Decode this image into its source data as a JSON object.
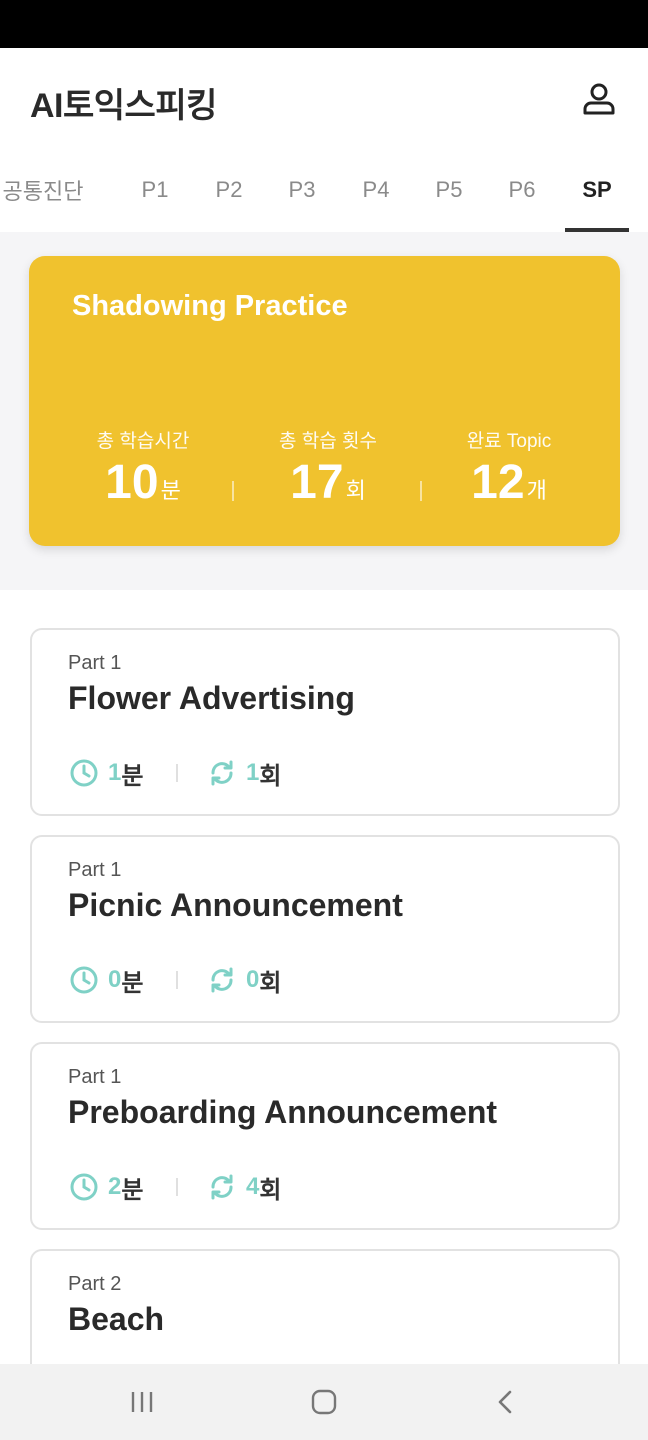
{
  "app": {
    "title": "AI토익스피킹"
  },
  "icons": {
    "profile": "person-icon",
    "time": "clock-icon",
    "count": "refresh-icon"
  },
  "colors": {
    "accent_yellow": "#f0c22e",
    "accent_teal": "#7fd1c6",
    "header_text": "#2a2a2a"
  },
  "tabs": [
    {
      "label": "공통진단",
      "active": false
    },
    {
      "label": "P1",
      "active": false
    },
    {
      "label": "P2",
      "active": false
    },
    {
      "label": "P3",
      "active": false
    },
    {
      "label": "P4",
      "active": false
    },
    {
      "label": "P5",
      "active": false
    },
    {
      "label": "P6",
      "active": false
    },
    {
      "label": "SP",
      "active": true
    }
  ],
  "summary": {
    "title": "Shadowing Practice",
    "stats": [
      {
        "label": "총 학습시간",
        "value": "10",
        "unit": "분"
      },
      {
        "label": "총 학습 횟수",
        "value": "17",
        "unit": "회"
      },
      {
        "label": "완료 Topic",
        "value": "12",
        "unit": "개"
      }
    ]
  },
  "topics": [
    {
      "part": "Part 1",
      "title": "Flower Advertising",
      "time": "1",
      "time_unit": "분",
      "count": "1",
      "count_unit": "회"
    },
    {
      "part": "Part 1",
      "title": "Picnic Announcement",
      "time": "0",
      "time_unit": "분",
      "count": "0",
      "count_unit": "회"
    },
    {
      "part": "Part 1",
      "title": "Preboarding Announcement",
      "time": "2",
      "time_unit": "분",
      "count": "4",
      "count_unit": "회"
    },
    {
      "part": "Part 2",
      "title": "Beach"
    }
  ],
  "navbar": {
    "recent": "recent-apps-icon",
    "home": "home-icon",
    "back": "back-icon"
  }
}
